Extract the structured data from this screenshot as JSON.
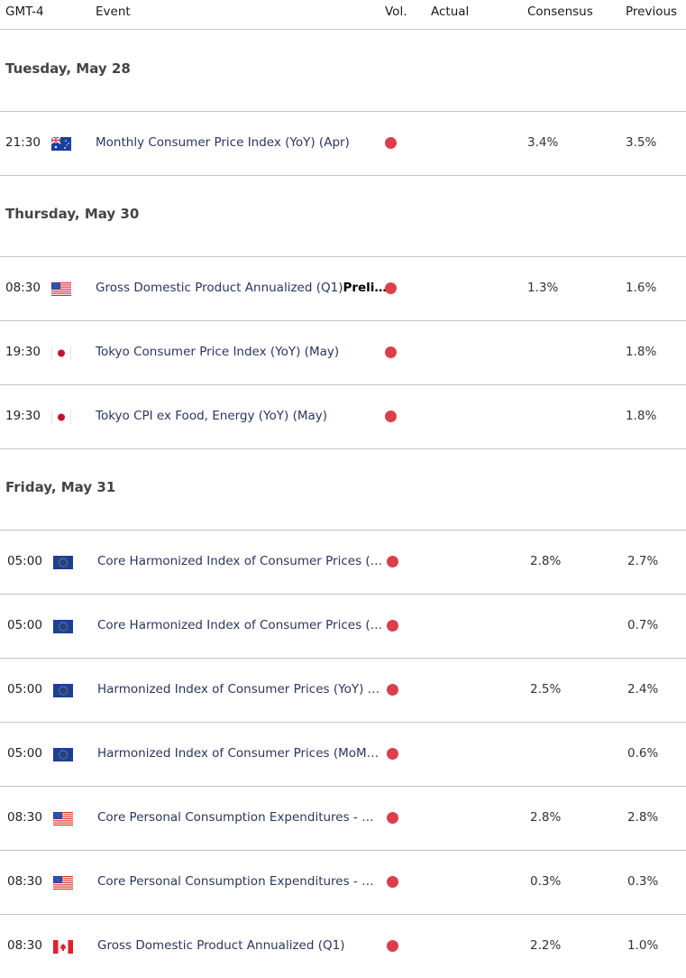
{
  "header": {
    "timezone": "GMT-4",
    "event": "Event",
    "vol": "Vol.",
    "actual": "Actual",
    "consensus": "Consensus",
    "previous": "Previous"
  },
  "colors": {
    "volatility_high": "#dc3f4a",
    "divider": "#c4c4c4"
  },
  "days": [
    {
      "label": "Tuesday, May 28",
      "events": [
        {
          "time": "21:30",
          "country": "australia-flag-icon",
          "name": "Monthly Consumer Price Index (YoY) (Apr)",
          "name_bold": "",
          "volatility": "high",
          "actual": "",
          "consensus": "3.4%",
          "previous": "3.5%"
        }
      ]
    },
    {
      "label": "Thursday, May 30",
      "events": [
        {
          "time": "08:30",
          "country": "usa-flag-icon",
          "name": "Gross Domestic Product Annualized (Q1)",
          "name_bold": "Preli…",
          "volatility": "high",
          "actual": "",
          "consensus": "1.3%",
          "previous": "1.6%"
        },
        {
          "time": "19:30",
          "country": "japan-flag-icon",
          "name": "Tokyo Consumer Price Index (YoY) (May)",
          "name_bold": "",
          "volatility": "high",
          "actual": "",
          "consensus": "",
          "previous": "1.8%"
        },
        {
          "time": "19:30",
          "country": "japan-flag-icon",
          "name": "Tokyo CPI ex Food, Energy (YoY) (May)",
          "name_bold": "",
          "volatility": "high",
          "actual": "",
          "consensus": "",
          "previous": "1.8%"
        }
      ]
    },
    {
      "label": "Friday, May 31",
      "events": [
        {
          "time": "05:00",
          "country": "eu-flag-icon",
          "name": "Core Harmonized Index of Consumer Prices (…",
          "name_bold": "",
          "volatility": "high",
          "actual": "",
          "consensus": "2.8%",
          "previous": "2.7%"
        },
        {
          "time": "05:00",
          "country": "eu-flag-icon",
          "name": "Core Harmonized Index of Consumer Prices (…",
          "name_bold": "",
          "volatility": "high",
          "actual": "",
          "consensus": "",
          "previous": "0.7%"
        },
        {
          "time": "05:00",
          "country": "eu-flag-icon",
          "name": "Harmonized Index of Consumer Prices (YoY) …",
          "name_bold": "",
          "volatility": "high",
          "actual": "",
          "consensus": "2.5%",
          "previous": "2.4%"
        },
        {
          "time": "05:00",
          "country": "eu-flag-icon",
          "name": "Harmonized Index of Consumer Prices (MoM…",
          "name_bold": "",
          "volatility": "high",
          "actual": "",
          "consensus": "",
          "previous": "0.6%"
        },
        {
          "time": "08:30",
          "country": "usa-flag-icon",
          "name": "Core Personal Consumption Expenditures - …",
          "name_bold": "",
          "volatility": "high",
          "actual": "",
          "consensus": "2.8%",
          "previous": "2.8%"
        },
        {
          "time": "08:30",
          "country": "usa-flag-icon",
          "name": "Core Personal Consumption Expenditures - …",
          "name_bold": "",
          "volatility": "high",
          "actual": "",
          "consensus": "0.3%",
          "previous": "0.3%"
        },
        {
          "time": "08:30",
          "country": "canada-flag-icon",
          "name": "Gross Domestic Product Annualized (Q1)",
          "name_bold": "",
          "volatility": "high",
          "actual": "",
          "consensus": "2.2%",
          "previous": "1.0%"
        }
      ]
    }
  ]
}
